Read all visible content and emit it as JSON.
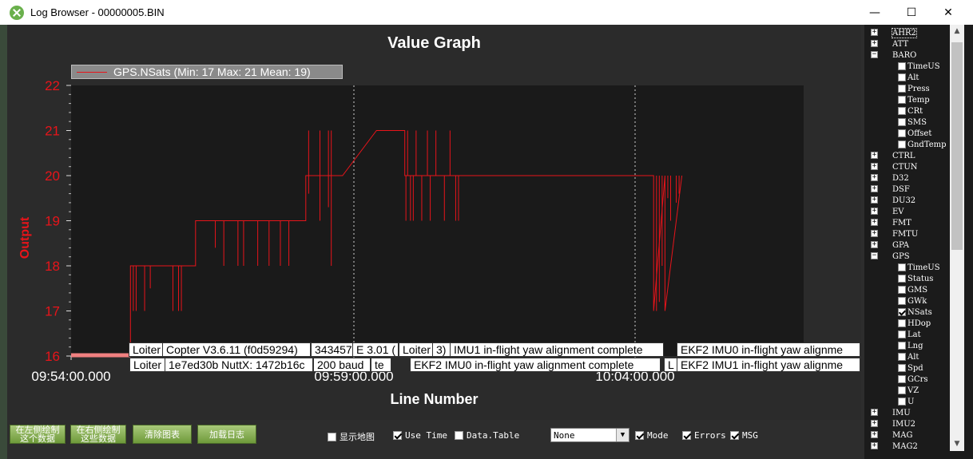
{
  "window": {
    "title": "Log Browser - 00000005.BIN",
    "controls": {
      "minimize": "—",
      "maximize": "☐",
      "close": "✕"
    }
  },
  "graph": {
    "title": "Value Graph",
    "x_axis_title": "Line Number",
    "y_axis_title": "Output",
    "legend": "GPS.NSats (Min: 17 Max: 21 Mean: 19)",
    "y_ticks": [
      "16",
      "17",
      "18",
      "19",
      "20",
      "21",
      "22"
    ],
    "x_ticks": [
      "09:54:00.000",
      "09:59:00.000",
      "10:04:00.000"
    ],
    "annotations": [
      {
        "text": "Loiter"
      },
      {
        "text": "Copter V3.6.11 (f0d59294)"
      },
      {
        "text": "343457"
      },
      {
        "text": "E 3.01 ("
      },
      {
        "text": "Loiter"
      },
      {
        "text": "3)"
      },
      {
        "text": "IMU1 in-flight yaw alignment complete"
      },
      {
        "text": "EKF2 IMU0 in-flight yaw alignme"
      },
      {
        "text": "Loiter"
      },
      {
        "text": "1e7ed30b NuttX: 1472b16c"
      },
      {
        "text": "200 baud"
      },
      {
        "text": "te"
      },
      {
        "text": "EKF2 IMU0 in-flight yaw alignment complete"
      },
      {
        "text": "L"
      },
      {
        "text": "EKF2 IMU1 in-flight yaw alignme"
      }
    ],
    "colors": {
      "series": "#e8141a",
      "plot_bg": "#1a1a1a",
      "outer_bg": "#2b2b2b"
    }
  },
  "chart_data": {
    "type": "line",
    "title": "Value Graph",
    "xlabel": "Line Number",
    "ylabel": "Output",
    "ylim": [
      16,
      22
    ],
    "x_tick_labels": [
      "09:54:00.000",
      "09:59:00.000",
      "10:04:00.000"
    ],
    "series": [
      {
        "name": "GPS.NSats (Min: 17 Max: 21 Mean: 19)",
        "x_minutes": [
          0.0,
          1.05,
          1.05,
          2.2,
          2.2,
          4.15,
          4.15,
          4.8,
          4.8,
          5.4,
          5.9,
          5.9,
          10.3,
          10.3,
          10.5,
          10.5,
          10.8
        ],
        "values": [
          16,
          16,
          18,
          18,
          19,
          19,
          20,
          20,
          20,
          21,
          21,
          20,
          20,
          17,
          20,
          17,
          20
        ]
      }
    ]
  },
  "bottom_bar": {
    "buttons": [
      {
        "label": "在左侧绘制\n这个数据"
      },
      {
        "label": "在右侧绘制\n这些数据"
      },
      {
        "label": "清除图表"
      },
      {
        "label": "加载日志"
      }
    ],
    "show_map": {
      "label": "显示地图",
      "checked": false
    },
    "use_time": {
      "label": "Use Time",
      "checked": true
    },
    "data_table": {
      "label": "Data.Table",
      "checked": false
    },
    "dropdown": {
      "value": "None"
    },
    "mode": {
      "label": "Mode",
      "checked": true
    },
    "errors": {
      "label": "Errors",
      "checked": true
    },
    "msg": {
      "label": "MSG",
      "checked": true
    }
  },
  "tree": {
    "items": [
      {
        "label": "AHR2",
        "type": "group",
        "expanded": false
      },
      {
        "label": "ATT",
        "type": "group",
        "expanded": false
      },
      {
        "label": "BARO",
        "type": "group",
        "expanded": true
      },
      {
        "label": "TimeUS",
        "type": "field",
        "checked": false
      },
      {
        "label": "Alt",
        "type": "field",
        "checked": false
      },
      {
        "label": "Press",
        "type": "field",
        "checked": false
      },
      {
        "label": "Temp",
        "type": "field",
        "checked": false
      },
      {
        "label": "CRt",
        "type": "field",
        "checked": false
      },
      {
        "label": "SMS",
        "type": "field",
        "checked": false
      },
      {
        "label": "Offset",
        "type": "field",
        "checked": false
      },
      {
        "label": "GndTemp",
        "type": "field",
        "checked": false
      },
      {
        "label": "CTRL",
        "type": "group",
        "expanded": false
      },
      {
        "label": "CTUN",
        "type": "group",
        "expanded": false
      },
      {
        "label": "D32",
        "type": "group",
        "expanded": false
      },
      {
        "label": "DSF",
        "type": "group",
        "expanded": false
      },
      {
        "label": "DU32",
        "type": "group",
        "expanded": false
      },
      {
        "label": "EV",
        "type": "group",
        "expanded": false
      },
      {
        "label": "FMT",
        "type": "group",
        "expanded": false
      },
      {
        "label": "FMTU",
        "type": "group",
        "expanded": false
      },
      {
        "label": "GPA",
        "type": "group",
        "expanded": false
      },
      {
        "label": "GPS",
        "type": "group",
        "expanded": true
      },
      {
        "label": "TimeUS",
        "type": "field",
        "checked": false
      },
      {
        "label": "Status",
        "type": "field",
        "checked": false
      },
      {
        "label": "GMS",
        "type": "field",
        "checked": false
      },
      {
        "label": "GWk",
        "type": "field",
        "checked": false
      },
      {
        "label": "NSats",
        "type": "field",
        "checked": true
      },
      {
        "label": "HDop",
        "type": "field",
        "checked": false
      },
      {
        "label": "Lat",
        "type": "field",
        "checked": false
      },
      {
        "label": "Lng",
        "type": "field",
        "checked": false
      },
      {
        "label": "Alt",
        "type": "field",
        "checked": false
      },
      {
        "label": "Spd",
        "type": "field",
        "checked": false
      },
      {
        "label": "GCrs",
        "type": "field",
        "checked": false
      },
      {
        "label": "VZ",
        "type": "field",
        "checked": false
      },
      {
        "label": "U",
        "type": "field",
        "checked": false
      },
      {
        "label": "IMU",
        "type": "group",
        "expanded": false
      },
      {
        "label": "IMU2",
        "type": "group",
        "expanded": false
      },
      {
        "label": "MAG",
        "type": "group",
        "expanded": false
      },
      {
        "label": "MAG2",
        "type": "group",
        "expanded": false
      }
    ]
  }
}
